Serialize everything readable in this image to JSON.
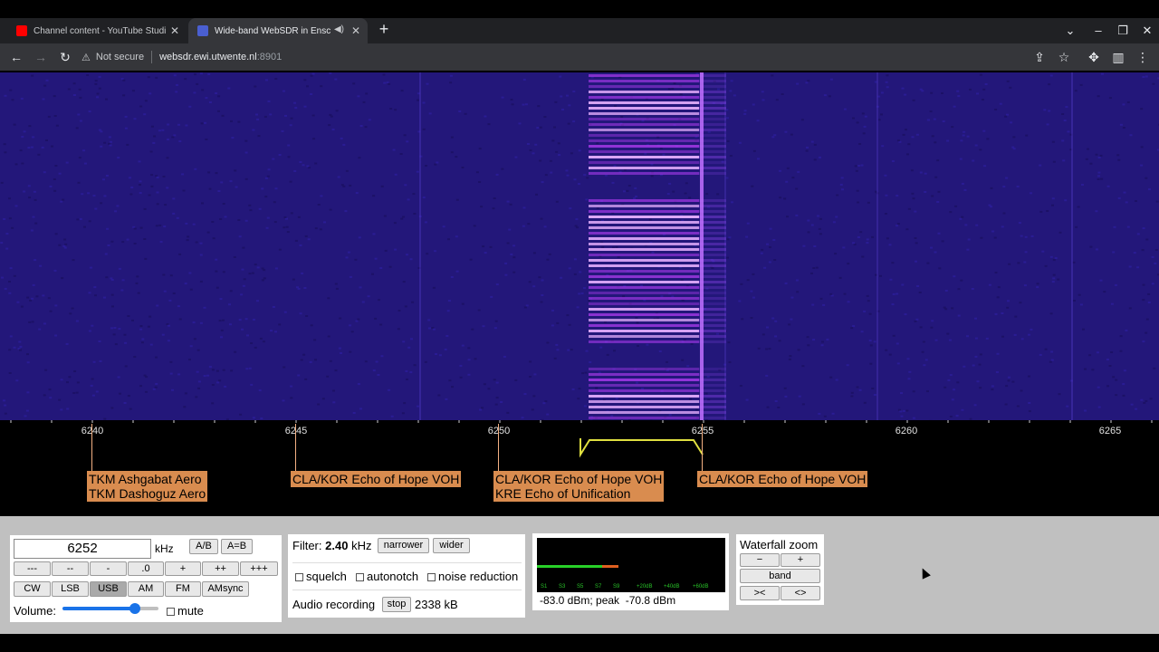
{
  "browser": {
    "tabs": [
      {
        "title": "Channel content - YouTube Studio",
        "active": false,
        "favicon": "youtube-icon"
      },
      {
        "title": "Wide-band WebSDR in Enschede",
        "active": true,
        "favicon": "websdr-icon",
        "audio": true
      }
    ],
    "address": {
      "security": "Not secure",
      "host": "websdr.ewi.utwente.nl",
      "port": ":8901"
    }
  },
  "scale": {
    "ticks": [
      {
        "label": "6240"
      },
      {
        "label": "6245"
      },
      {
        "label": "6250"
      },
      {
        "label": "6255"
      },
      {
        "label": "6260"
      },
      {
        "label": "6265"
      }
    ],
    "stations": [
      {
        "text": "TKM Ashgabat Aero\nTKM Dashoguz Aero"
      },
      {
        "text": "CLA/KOR Echo of Hope VOH"
      },
      {
        "text": "CLA/KOR Echo of Hope VOH\nKRE Echo of Unification"
      },
      {
        "text": "CLA/KOR Echo of Hope VOH"
      }
    ]
  },
  "controls": {
    "frequency": "6252",
    "freq_unit": "kHz",
    "ab": "A/B",
    "a_eq_b": "A=B",
    "steps": [
      "---",
      "--",
      "-",
      ".0",
      "+",
      "++",
      "+++"
    ],
    "modes": [
      "CW",
      "LSB",
      "USB",
      "AM",
      "FM",
      "AMsync"
    ],
    "selected_mode": "USB",
    "volume_label": "Volume:",
    "volume_level": 0.75,
    "mute_label": "mute",
    "filter_label": "Filter:",
    "filter_value": "2.40",
    "filter_unit": "kHz",
    "narrower": "narrower",
    "wider": "wider",
    "squelch": "squelch",
    "autonotch": "autonotch",
    "noise_reduction": "noise reduction",
    "audio_recording": "Audio recording",
    "stop": "stop",
    "recording_size": "2338 kB",
    "smeter_scale": [
      "S1",
      "S3",
      "S5",
      "S7",
      "S9",
      "+20dB",
      "+40dB",
      "+60dB"
    ],
    "signal_text": "-83.0 dBm; peak  -70.8 dBm",
    "waterfall_zoom": "Waterfall zoom",
    "zoom_minus": "−",
    "zoom_plus": "+",
    "zoom_band": "band",
    "zoom_in": "><",
    "zoom_out": "<>"
  },
  "colors": {
    "waterfall_bg": "#23177a",
    "signal": "#c040ff",
    "station_label": "#d98c4f",
    "passband": "#e0e040"
  }
}
